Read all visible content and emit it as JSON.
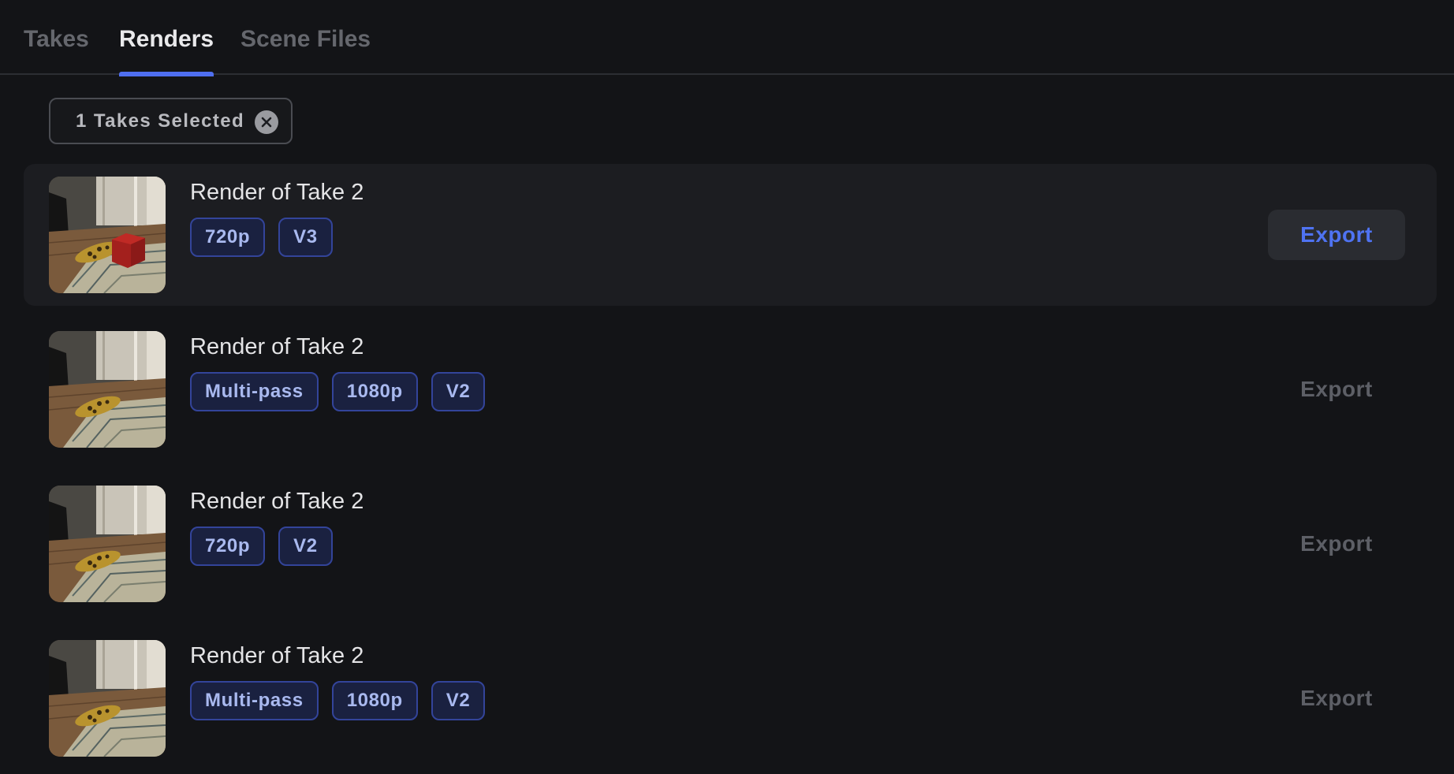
{
  "tabs": [
    {
      "label": "Takes",
      "active": false
    },
    {
      "label": "Renders",
      "active": true
    },
    {
      "label": "Scene Files",
      "active": false
    }
  ],
  "filter": {
    "label": "1 Takes Selected",
    "clear_icon": "close-circle-icon"
  },
  "renders": [
    {
      "title": "Render of Take 2",
      "tags": [
        "720p",
        "V3"
      ],
      "export_label": "Export",
      "selected": true,
      "thumbnail": "room-floor-with-red-cube"
    },
    {
      "title": "Render of Take 2",
      "tags": [
        "Multi-pass",
        "1080p",
        "V2"
      ],
      "export_label": "Export",
      "selected": false,
      "thumbnail": "room-floor"
    },
    {
      "title": "Render of Take 2",
      "tags": [
        "720p",
        "V2"
      ],
      "export_label": "Export",
      "selected": false,
      "thumbnail": "room-floor"
    },
    {
      "title": "Render of Take 2",
      "tags": [
        "Multi-pass",
        "1080p",
        "V2"
      ],
      "export_label": "Export",
      "selected": false,
      "thumbnail": "room-floor"
    }
  ],
  "colors": {
    "background": "#131417",
    "selected_row": "#1c1d21",
    "accent": "#4f6ff0",
    "tag_border": "#33449a",
    "tag_text": "#a9b9ef"
  }
}
